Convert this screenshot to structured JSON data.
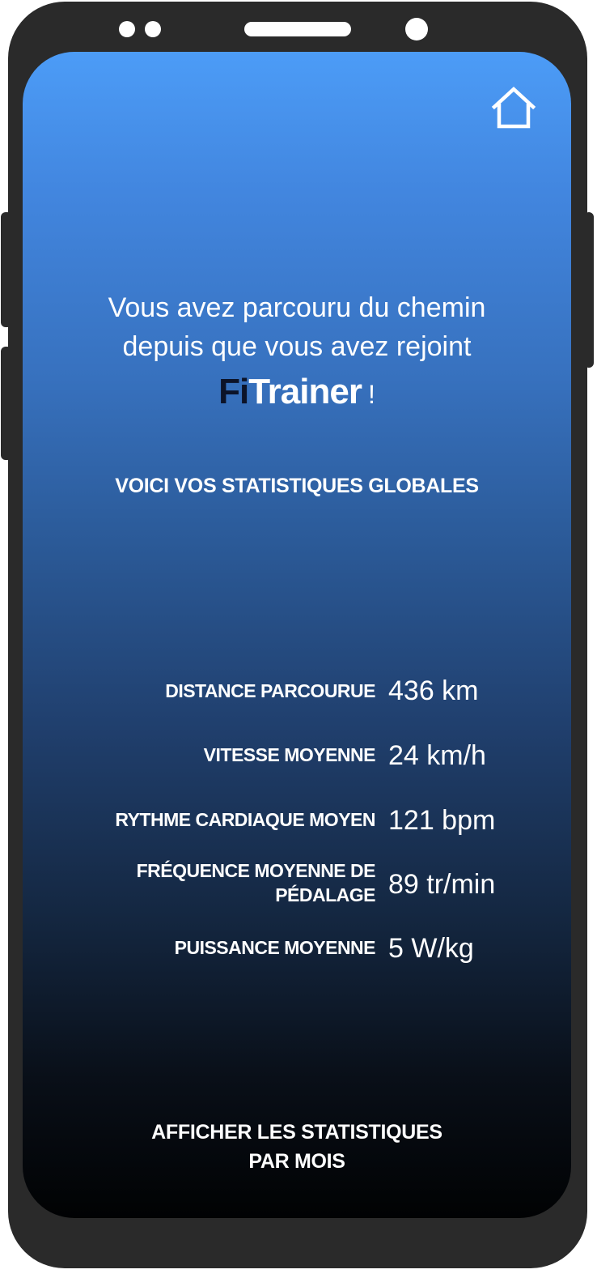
{
  "header": {
    "home_icon": "home-icon"
  },
  "intro": {
    "line1": "Vous avez parcouru du chemin",
    "line2": "depuis que vous avez rejoint",
    "brand_fi": "Fi",
    "brand_rest": "Trainer",
    "brand_excl": "!"
  },
  "section_title": "VOICI VOS STATISTIQUES GLOBALES",
  "stats": [
    {
      "label": "DISTANCE PARCOURUE",
      "value": "436 km"
    },
    {
      "label": "VITESSE MOYENNE",
      "value": "24 km/h"
    },
    {
      "label": "RYTHME CARDIAQUE MOYEN",
      "value": "121 bpm"
    },
    {
      "label_line1": "FRÉQUENCE MOYENNE DE",
      "label_line2": "PÉDALAGE",
      "value": "89 tr/min"
    },
    {
      "label": "PUISSANCE MOYENNE",
      "value": "5 W/kg"
    }
  ],
  "bottom_button": {
    "line1": "AFFICHER LES STATISTIQUES",
    "line2": "PAR MOIS"
  },
  "colors": {
    "gradient_top": "#4c9cf7",
    "gradient_bottom": "#010203",
    "brand_fi": "#0c1328",
    "device_frame": "#2a2a2a"
  }
}
